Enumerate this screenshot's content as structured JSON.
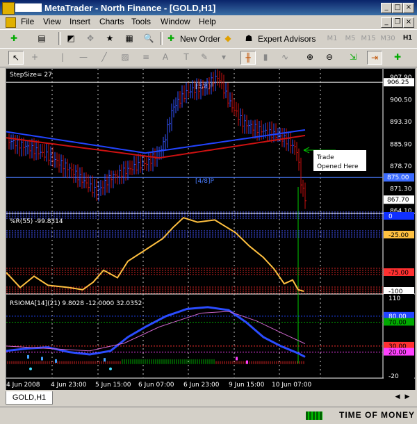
{
  "window": {
    "title": "MetaTrader - North Finance - [GOLD,H1]"
  },
  "menu": [
    "File",
    "View",
    "Insert",
    "Charts",
    "Tools",
    "Window",
    "Help"
  ],
  "toolbar": {
    "new_order": "New Order",
    "expert_advisors": "Expert Advisors",
    "periods": [
      "M1",
      "M5",
      "M15",
      "M30",
      "H1"
    ],
    "active_period": "H1"
  },
  "chart_data": {
    "symbol": "GOLD,H1",
    "type": "candlestick",
    "main_label": "StepSize= 27",
    "levels": [
      {
        "label": "[5/8]P",
        "value": 906.25,
        "color": "#ffffff"
      },
      {
        "label": "[4/8]P",
        "value": 875.0,
        "color": "#4a7cff"
      }
    ],
    "price_ticks": [
      "907.90",
      "900.50",
      "893.30",
      "885.90",
      "878.70",
      "871.30",
      "864.10"
    ],
    "price_badges": [
      {
        "value": "906.25",
        "bg": "#ffffff",
        "fg": "#000000"
      },
      {
        "value": "875.00",
        "bg": "#3b6bff",
        "fg": "#ffffff"
      },
      {
        "value": "867.70",
        "bg": "#ffffff",
        "fg": "#000000"
      }
    ],
    "ylim": [
      864.1,
      907.9
    ],
    "annotation": [
      "Trade",
      "Opened Here"
    ],
    "x_ticks": [
      "4 Jun 2008",
      "4 Jun 23:00",
      "5 Jun 15:00",
      "6 Jun 07:00",
      "6 Jun 23:00",
      "9 Jun 15:00",
      "10 Jun 07:00"
    ],
    "panels": [
      {
        "label": "%R(55) -99.8314",
        "ticks": [
          "0",
          "-25.00",
          "-75.00",
          "-100"
        ]
      },
      {
        "label": "RSIOMA[14](21) 9.8028 -12.0000 32.0352",
        "ticks": [
          "110",
          "80.00",
          "70.00",
          "30.00",
          "20.00",
          "-20"
        ]
      }
    ]
  },
  "tabs": {
    "active": "GOLD,H1"
  },
  "status": {
    "watermark": "TIME OF MONEY"
  },
  "colors": {
    "bull": "#3355ff",
    "bear": "#cc1111",
    "ma_fast": "#2244ff",
    "ma_slow": "#cc1111",
    "willr": "#ffc040",
    "rsioma": "#2a4cff",
    "signal": "#cc66cc"
  }
}
